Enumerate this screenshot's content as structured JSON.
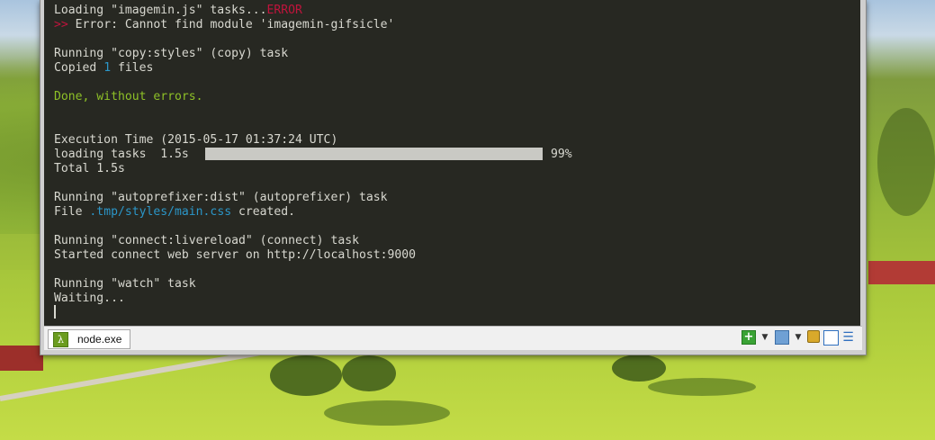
{
  "terminal": {
    "lines": [
      {
        "prefix": "Loading \"imagemin.js\" tasks...",
        "status": "ERROR"
      },
      {
        "marker": ">>",
        "text": " Error: Cannot find module 'imagemin-gifsicle'"
      },
      {
        "text": "Running \"copy:styles\" (copy) task"
      },
      {
        "prefix": "Copied ",
        "count": "1",
        "suffix": " files"
      },
      {
        "text": "Done, without errors."
      },
      {
        "text": "Execution Time (2015-05-17 01:37:24 UTC)"
      },
      {
        "label": "loading tasks  1.5s",
        "percent_text": "99%",
        "progress": 0.99
      },
      {
        "text": "Total 1.5s"
      },
      {
        "text": "Running \"autoprefixer:dist\" (autoprefixer) task"
      },
      {
        "prefix": "File ",
        "path": ".tmp/styles/main.css",
        "suffix": " created."
      },
      {
        "text": "Running \"connect:livereload\" (connect) task"
      },
      {
        "text": "Started connect web server on http://localhost:9000"
      },
      {
        "text": "Running \"watch\" task"
      },
      {
        "text": "Waiting..."
      }
    ]
  },
  "statusbar": {
    "tab_icon": "lambda-icon",
    "tab_glyph": "λ",
    "tab_label": "node.exe",
    "new_console_glyph": "+",
    "dropdown_glyph": "▼",
    "menu_glyph": "☰"
  },
  "colors": {
    "terminal_bg": "#272822",
    "error": "#c0143c",
    "highlight": "#2b96c8",
    "success": "#8ec127"
  }
}
